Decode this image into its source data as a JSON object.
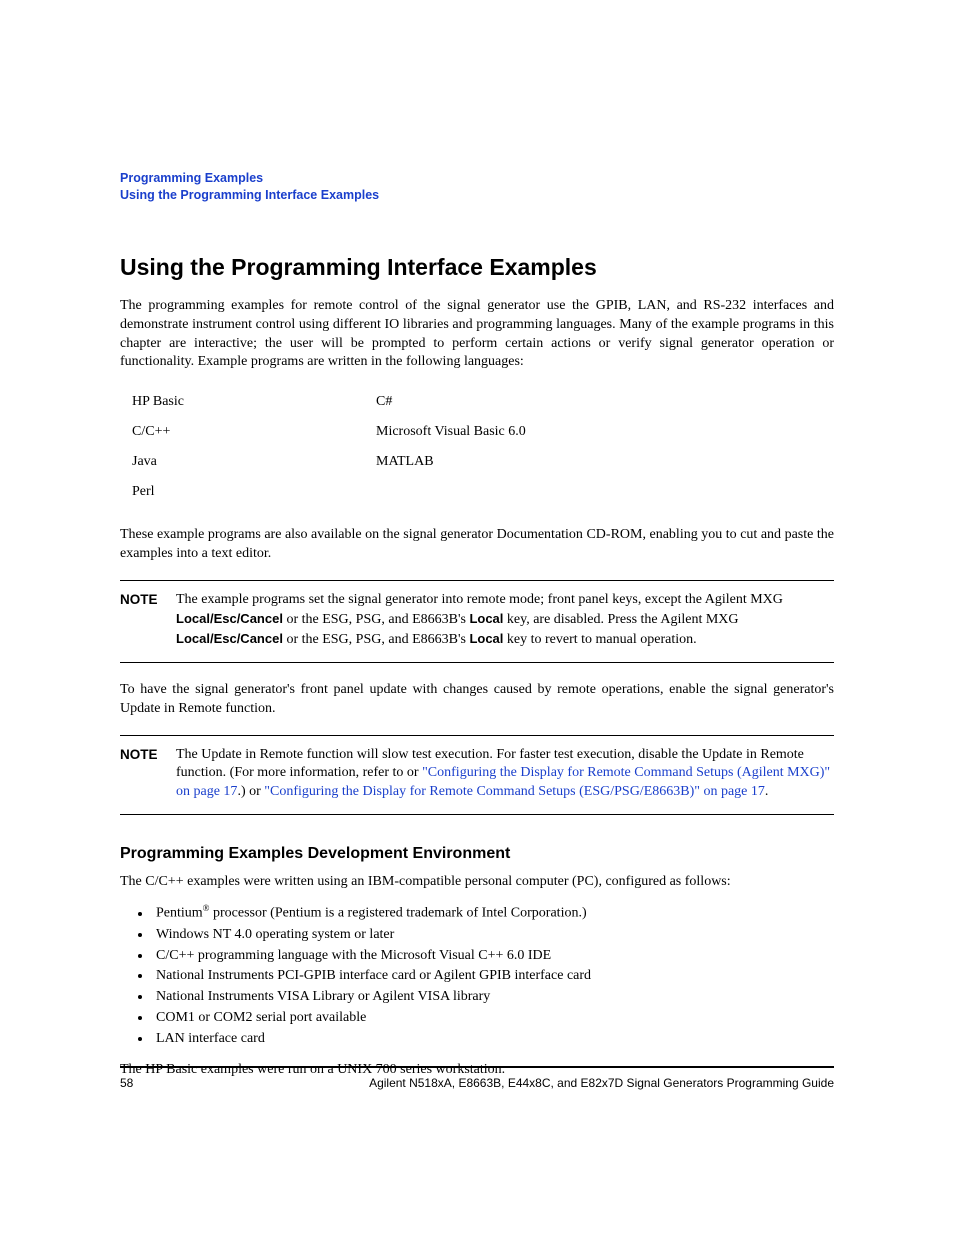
{
  "header": {
    "line1": "Programming Examples",
    "line2": "Using the Programming Interface Examples"
  },
  "heading": "Using the Programming Interface Examples",
  "intro": "The programming examples for remote control of the signal generator use the GPIB, LAN, and RS-232 interfaces and demonstrate instrument control using different IO libraries and programming languages. Many of the example programs in this chapter are interactive; the user will be prompted to perform certain actions or verify signal generator operation or functionality. Example programs are written in the following languages:",
  "langs": {
    "r1c1": "HP Basic",
    "r1c2": "C#",
    "r2c1": "C/C++",
    "r2c2": "Microsoft Visual Basic 6.0",
    "r3c1": "Java",
    "r3c2": "MATLAB",
    "r4c1": "Perl",
    "r4c2": ""
  },
  "afterLangs": "These example programs are also available on the signal generator Documentation CD-ROM, enabling you to cut and paste the examples into a text editor.",
  "note1": {
    "label": "NOTE",
    "t1": "The example programs set the signal generator into remote mode; front panel keys, except the Agilent MXG ",
    "b1": "Local/Esc/Cancel",
    "t2": " or the ESG, PSG, and E8663B's ",
    "b2": "Local",
    "t3": " key, are disabled. Press the Agilent MXG ",
    "b3": "Local/Esc/Cancel",
    "t4": " or the ESG, PSG, and E8663B's ",
    "b4": "Local",
    "t5": " key to revert to manual operation."
  },
  "afterNote1": "To have the signal generator's front panel update with changes caused by remote operations, enable the signal generator's Update in Remote function.",
  "note2": {
    "label": "NOTE",
    "t1": "The Update in Remote function will slow test execution. For faster test execution, disable the Update in Remote function. (For more information, refer to or ",
    "link1": "\"Configuring the Display for Remote Command Setups (Agilent MXG)\" on page 17",
    "t2": ".) or ",
    "link2": "\"Configuring the Display for Remote Command Setups (ESG/PSG/E8663B)\" on page 17",
    "t3": "."
  },
  "subheading": "Programming Examples Development Environment",
  "devIntro": "The C/C++ examples were written using an IBM-compatible personal computer (PC), configured as follows:",
  "bullets": {
    "b1a": "Pentium",
    "b1b": " processor (Pentium is a registered trademark of Intel Corporation.)",
    "b2": "Windows NT 4.0 operating system or later",
    "b3": "C/C++ programming language with the Microsoft Visual C++ 6.0 IDE",
    "b4": "National Instruments PCI-GPIB interface card or Agilent GPIB interface card",
    "b5": "National Instruments VISA Library or Agilent VISA library",
    "b6": "COM1 or COM2 serial port available",
    "b7": "LAN interface card"
  },
  "devOutro": "The HP Basic examples were run on a UNIX 700 series workstation.",
  "footer": {
    "pageNum": "58",
    "title": "Agilent N518xA, E8663B, E44x8C, and E82x7D Signal Generators Programming Guide"
  }
}
